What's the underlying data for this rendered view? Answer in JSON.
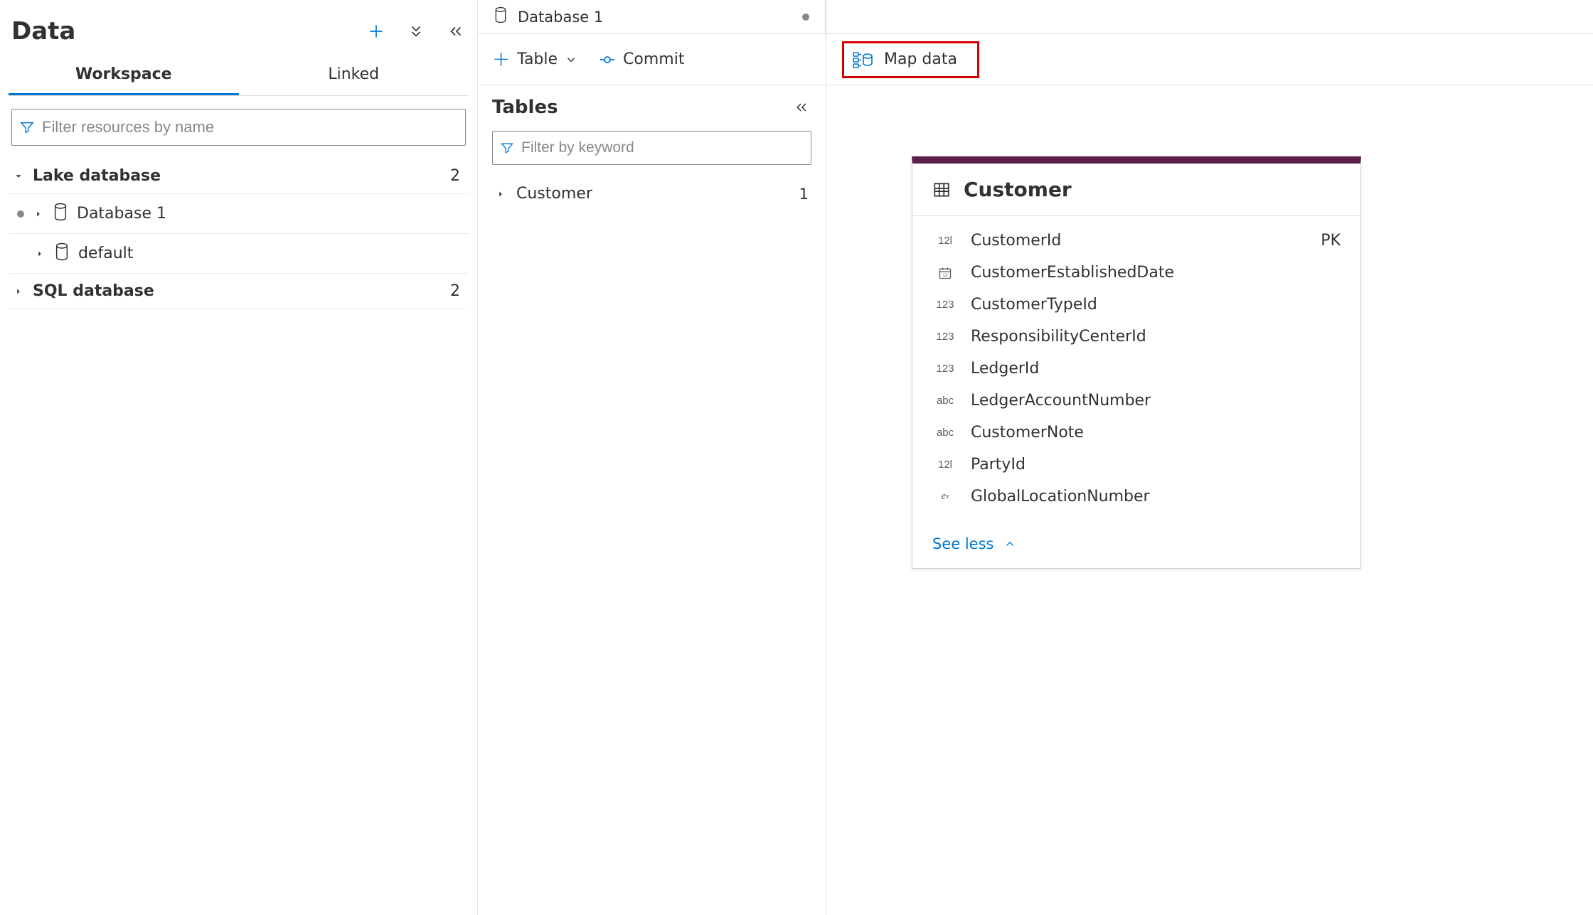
{
  "data_panel": {
    "title": "Data",
    "tabs": {
      "workspace": "Workspace",
      "linked": "Linked"
    },
    "filter_placeholder": "Filter resources by name",
    "lake_db": {
      "label": "Lake database",
      "count": "2"
    },
    "lake_items": [
      {
        "label": "Database 1"
      },
      {
        "label": "default"
      }
    ],
    "sql_db": {
      "label": "SQL database",
      "count": "2"
    }
  },
  "top_tab": {
    "label": "Database 1"
  },
  "cmdbar": {
    "table": "Table",
    "commit": "Commit",
    "map_data": "Map data"
  },
  "tables_panel": {
    "title": "Tables",
    "filter_placeholder": "Filter by keyword",
    "items": [
      {
        "label": "Customer",
        "count": "1"
      }
    ]
  },
  "entity": {
    "name": "Customer",
    "see_less": "See less",
    "columns": [
      {
        "type": "12l",
        "name": "CustomerId",
        "key": "PK"
      },
      {
        "type": "date",
        "name": "CustomerEstablishedDate",
        "key": ""
      },
      {
        "type": "123",
        "name": "CustomerTypeId",
        "key": ""
      },
      {
        "type": "123",
        "name": "ResponsibilityCenterId",
        "key": ""
      },
      {
        "type": "123",
        "name": "LedgerId",
        "key": ""
      },
      {
        "type": "abc",
        "name": "LedgerAccountNumber",
        "key": ""
      },
      {
        "type": "abc",
        "name": "CustomerNote",
        "key": ""
      },
      {
        "type": "12l",
        "name": "PartyId",
        "key": ""
      },
      {
        "type": "ex",
        "name": "GlobalLocationNumber",
        "key": ""
      }
    ]
  }
}
